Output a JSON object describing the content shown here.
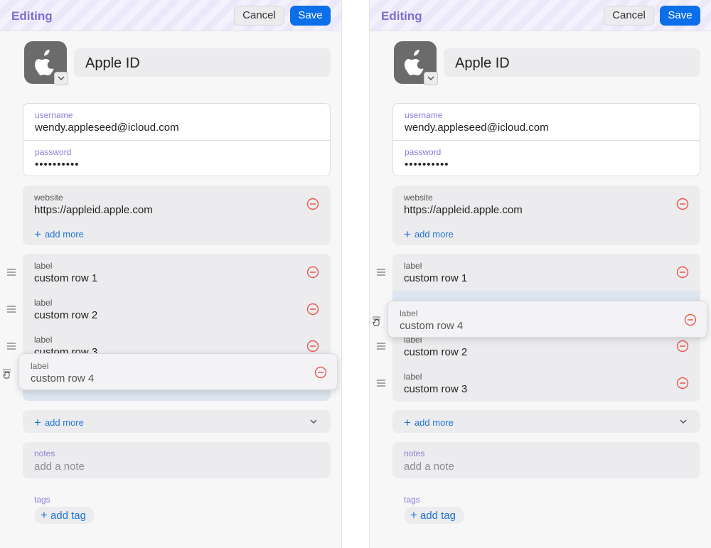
{
  "header": {
    "title": "Editing",
    "cancel_label": "Cancel",
    "save_label": "Save"
  },
  "item": {
    "title": "Apple ID",
    "icon": "apple-logo-icon"
  },
  "credentials": {
    "username_label": "username",
    "username_value": "wendy.appleseed@icloud.com",
    "password_label": "password",
    "password_value": "••••••••••"
  },
  "website": {
    "label": "website",
    "value": "https://appleid.apple.com",
    "add_more": "add more"
  },
  "custom_rows": [
    {
      "label": "label",
      "value": "custom row 1"
    },
    {
      "label": "label",
      "value": "custom row 2"
    },
    {
      "label": "label",
      "value": "custom row 3"
    },
    {
      "label": "label",
      "value": "custom row 4"
    }
  ],
  "custom_add_more": "add more",
  "notes": {
    "label": "notes",
    "placeholder": "add a note"
  },
  "tags": {
    "label": "tags",
    "add_label": "add tag"
  },
  "colors": {
    "accent": "#0a6fe8",
    "title": "#7a6fd2",
    "remove": "#e8574d",
    "link": "#1f73d8"
  }
}
